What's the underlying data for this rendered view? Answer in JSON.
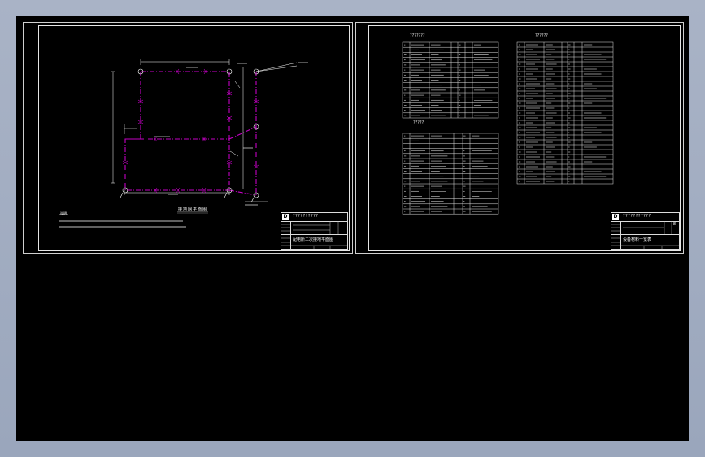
{
  "sheet1": {
    "tag": "D",
    "title_block_header": "??????????",
    "drawing_title": "配电所二次接地平面图",
    "plan_label": "接地网平面图",
    "notes_heading": "说明"
  },
  "sheet2": {
    "tag": "D",
    "title_block_header": "???????????",
    "drawing_title": "设备材料一览表",
    "sheet_number": "8",
    "table1_title": "???????",
    "table2_title": "?????",
    "table3_title": "??????"
  },
  "colors": {
    "background": "#000000",
    "frame": "#e6e6e6",
    "grounding_line": "#c400c4",
    "dimension_line": "#ffffff",
    "canvas_bezel": "#a2adc2"
  }
}
